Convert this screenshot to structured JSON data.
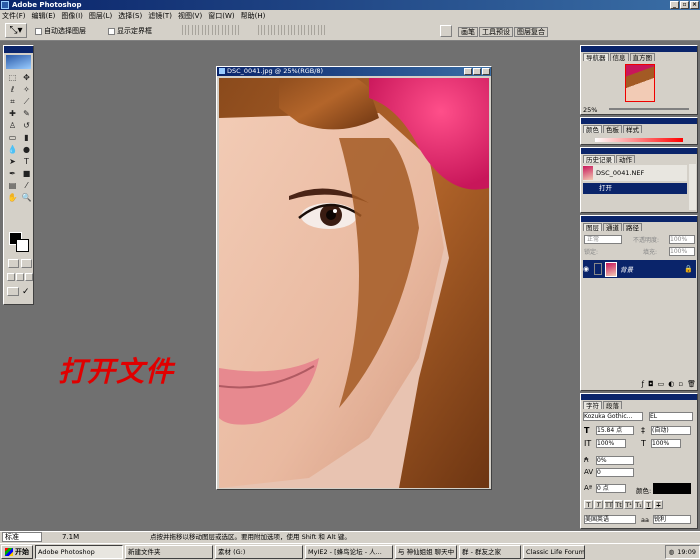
{
  "app": {
    "title": "Adobe Photoshop"
  },
  "menu": [
    "文件(F)",
    "编辑(E)",
    "图像(I)",
    "图层(L)",
    "选择(S)",
    "滤镜(T)",
    "视图(V)",
    "窗口(W)",
    "帮助(H)"
  ],
  "options": {
    "auto_select_layer": "自动选择图层",
    "show_bounding_box": "显示定界框"
  },
  "palette_well": [
    "画笔",
    "工具预设",
    "图层复合"
  ],
  "document": {
    "title": "DSC_0041.jpg @ 25%(RGB/8)"
  },
  "overlay_caption": "打开文件",
  "navigator": {
    "tabs": [
      "导航器",
      "信息",
      "直方图"
    ],
    "zoom": "25%"
  },
  "color_panel": {
    "tabs": [
      "颜色",
      "色板",
      "样式"
    ]
  },
  "history": {
    "tabs": [
      "历史记录",
      "动作"
    ],
    "snapshot": "DSC_0041.NEF",
    "step": "打开"
  },
  "layers": {
    "tabs": [
      "图层",
      "通道",
      "路径"
    ],
    "blend_mode": "正常",
    "opacity_label": "不透明度:",
    "opacity": "100%",
    "lock_label": "锁定:",
    "fill_label": "填充:",
    "fill": "100%",
    "layer_name": "背景"
  },
  "character": {
    "tabs": [
      "字符",
      "段落"
    ],
    "font": "Kozuka Gothic...",
    "style": "EL",
    "size": "15.84 点",
    "leading": "(自动)",
    "vscale": "100%",
    "hscale": "100%",
    "kerning": "0%",
    "tracking": "0",
    "baseline": "0 点",
    "color_label": "颜色:",
    "language": "美国英语",
    "aa_label": "aa",
    "aa": "锐利"
  },
  "status": {
    "zoom_label": "标准",
    "docsize": "7.1M",
    "hint": "点按并拖移以移动图层或选区。要用附加选项，使用 Shift 和 Alt 键。"
  },
  "taskbar": {
    "start": "开始",
    "tasks": [
      "Adobe Photoshop",
      "新建文件夹",
      "素材 (G:)",
      "MyIE2 - [蜂鸟论坛 - 人...",
      "与 神仙姐姐 聊天中",
      "群 - 群友之家",
      "Classic Life Forum - [人..."
    ],
    "clock": "19:09"
  },
  "colors": {
    "title_blue": "#0a246a",
    "caption_red": "#e00000",
    "layer_highlight": "#0a246a"
  }
}
